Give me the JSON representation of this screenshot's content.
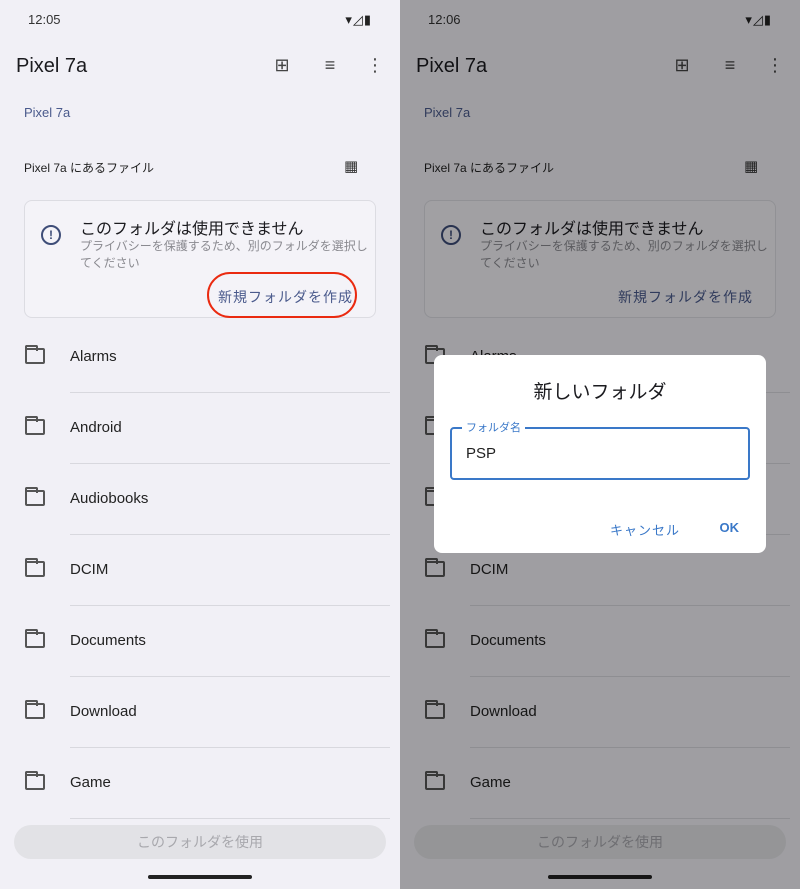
{
  "left": {
    "time": "12:05"
  },
  "right": {
    "time": "12:06"
  },
  "status_icons": "▾◿▮",
  "title": "Pixel 7a",
  "breadcrumb": "Pixel 7a",
  "section": "Pixel 7a にあるファイル",
  "notice": {
    "heading": "このフォルダは使用できません",
    "desc": "プライバシーを保護するため、別のフォルダを選択してください",
    "action": "新規フォルダを作成"
  },
  "folders": [
    "Alarms",
    "Android",
    "Audiobooks",
    "DCIM",
    "Documents",
    "Download",
    "Game"
  ],
  "use_button": "このフォルダを使用",
  "dialog": {
    "title": "新しいフォルダ",
    "field_label": "フォルダ名",
    "field_value": "PSP",
    "cancel": "キャンセル",
    "ok": "OK"
  },
  "highlight_color": "#ea2a10"
}
